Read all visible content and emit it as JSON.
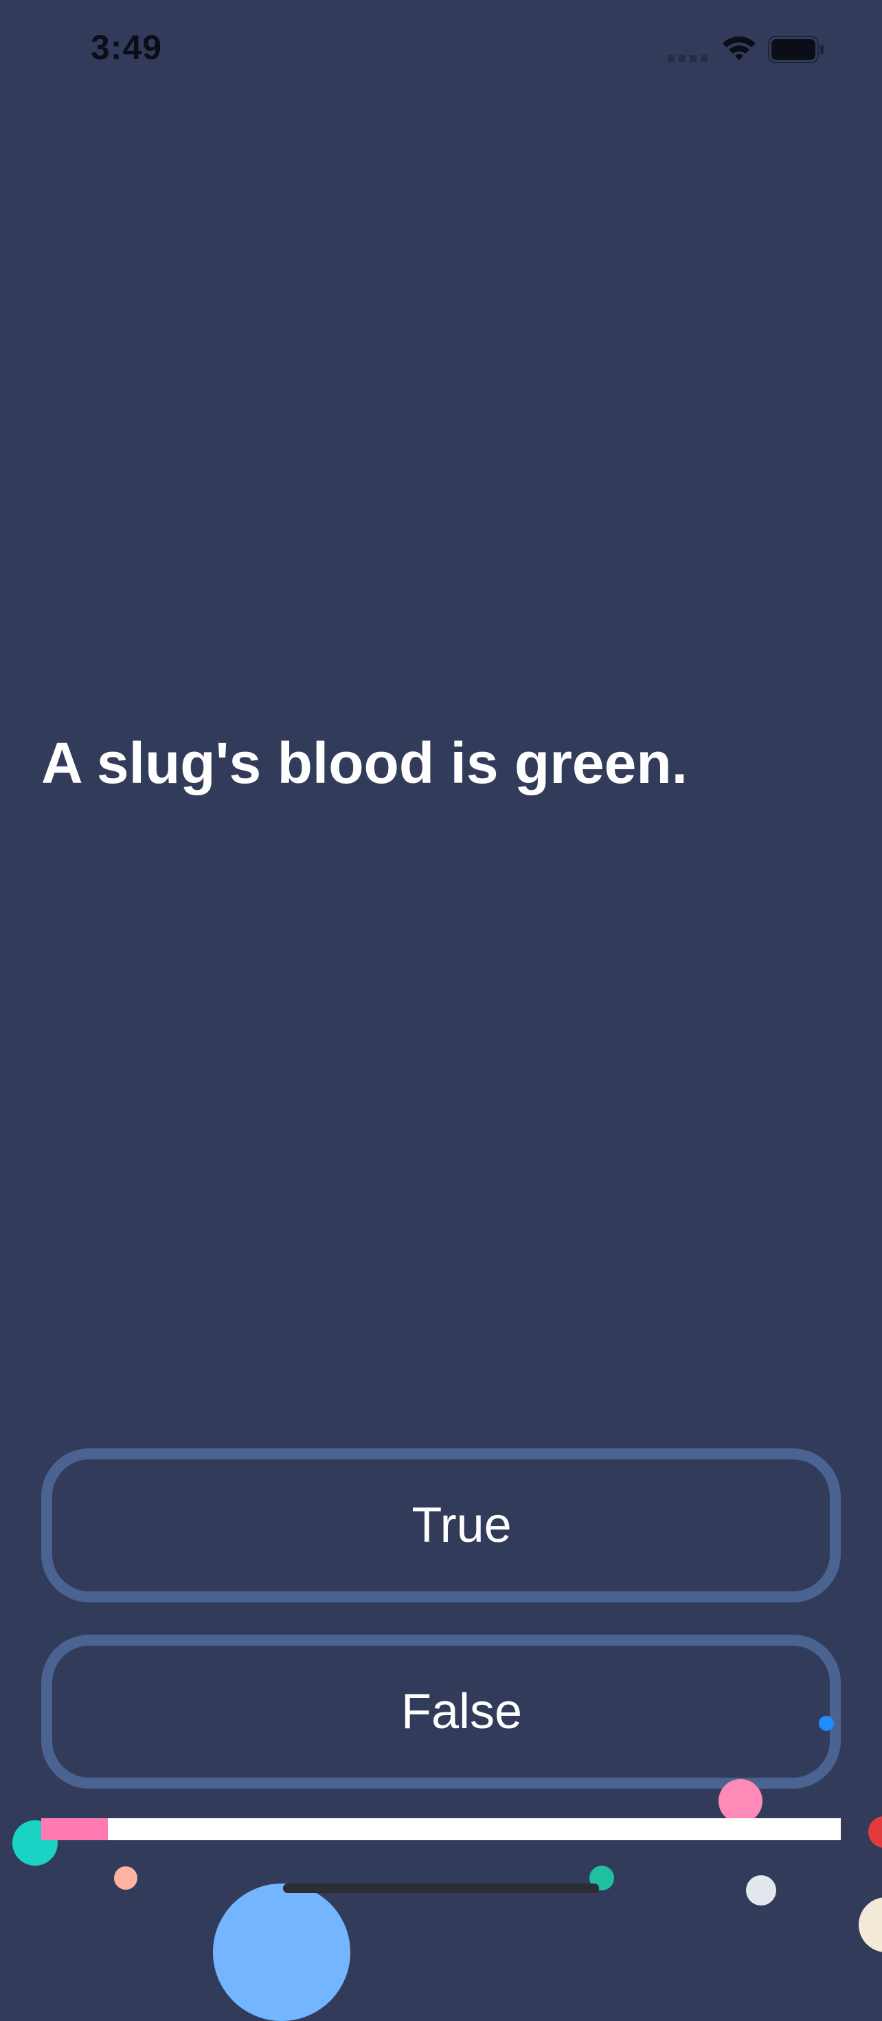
{
  "status_bar": {
    "time": "3:49",
    "icons": [
      "cellular-signal-icon",
      "wifi-icon",
      "battery-icon"
    ]
  },
  "quiz": {
    "question": "A slug's blood is green.",
    "answers": {
      "true_label": "True",
      "false_label": "False"
    },
    "progress_fraction": 0.083
  },
  "colors": {
    "background": "#323c5a",
    "button_border": "#4a6391",
    "progress_track": "#ffffff",
    "progress_fill": "#ff7ab0",
    "text": "#ffffff",
    "confetti": [
      "#19d3c5",
      "#ffb3a0",
      "#73b6ff",
      "#1fbfa0",
      "#ff8ab7",
      "#e2e8ee",
      "#1f8cff",
      "#e33b3b",
      "#f3ead8"
    ]
  }
}
